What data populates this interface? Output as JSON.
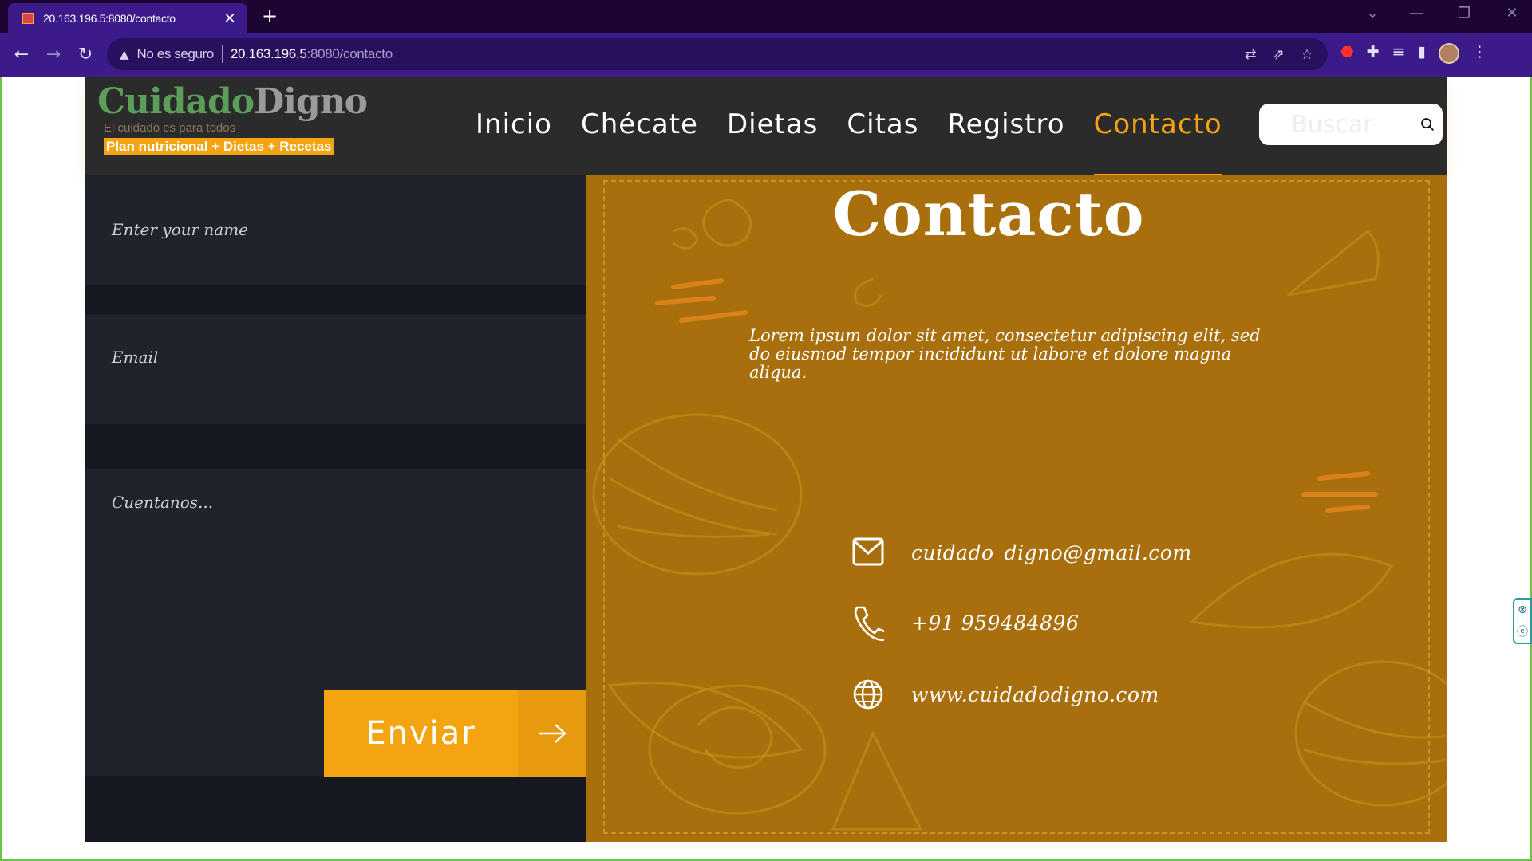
{
  "browser": {
    "tab_title": "20.163.196.5:8080/contacto",
    "tab_close": "✕",
    "new_tab": "+",
    "security_label": "No es seguro",
    "url_host": "20.163.196.5",
    "url_rest": ":8080/contacto"
  },
  "site": {
    "brand_part1": "Cuidado",
    "brand_part2": "Digno",
    "tagline": "El cuidado es para todos",
    "plan": "Plan nutricional + Dietas + Recetas",
    "nav": [
      "Inicio",
      "Chécate",
      "Dietas",
      "Citas",
      "Registro",
      "Contacto"
    ],
    "active_nav": "Contacto",
    "search_placeholder": "Buscar"
  },
  "form": {
    "name_placeholder": "Enter your name",
    "email_placeholder": "Email",
    "message_placeholder": "Cuentanos...",
    "submit_label": "Enviar"
  },
  "contact": {
    "title": "Contacto",
    "description": "Lorem ipsum dolor sit amet, consectetur adipiscing elit, sed do eiusmod tempor incididunt ut labore et dolore magna aliqua.",
    "email": "cuidado_digno@gmail.com",
    "phone": "+91 959484896",
    "website": "www.cuidadodigno.com"
  },
  "colors": {
    "accent": "#f4a311",
    "panel": "#a96f0c",
    "browser_chrome": "#3d1a8a",
    "form_bg": "#15181f",
    "field_bg": "#20232c"
  }
}
